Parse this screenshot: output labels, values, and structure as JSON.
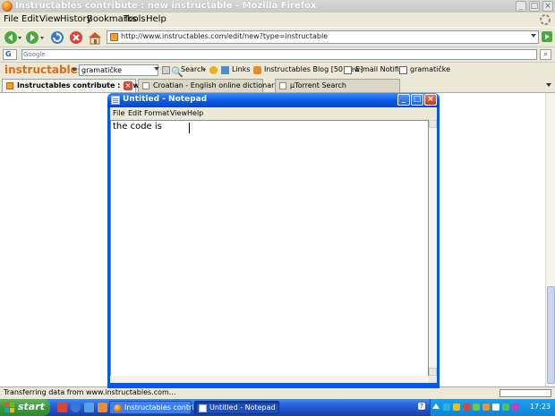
{
  "firefox": {
    "title": "Instructables contribute : new instructable - Mozilla Firefox",
    "menu": [
      "File",
      "Edit",
      "View",
      "History",
      "Bookmarks",
      "Tools",
      "Help"
    ],
    "url": "http://www.instructables.com/edit/new?type=instructable",
    "google_placeholder": "Google",
    "google_logo": "G",
    "instructables_toolbar": {
      "logo": "instructables",
      "search_value": "gramatičke",
      "search_label": "Search",
      "links_label": "Links",
      "blog_label": "Instructables Blog [50 new]",
      "email_label": "E-mail Notifier",
      "last_label": "gramatičke"
    },
    "tabs": [
      {
        "label": "Instructables contribute : new ins...",
        "active": true
      },
      {
        "label": "Croatian - English online dictionary | H...",
        "active": false
      },
      {
        "label": "µTorrent Search",
        "active": false
      }
    ],
    "status_text": "Transferring data from www.instructables.com...",
    "progress": 0.0
  },
  "notepad": {
    "title": "Untitled - Notepad",
    "menu": [
      "File",
      "Edit",
      "Format",
      "View",
      "Help"
    ],
    "text": "the code is"
  },
  "taskbar": {
    "start_label": "start",
    "buttons": [
      "Instructables contrib...",
      "Untitled - Notepad"
    ],
    "clock": "17:23"
  },
  "colors": {
    "xp_blue": "#245edb",
    "start_green": "#3a9a3a",
    "instructables_orange": "#e86a10"
  }
}
